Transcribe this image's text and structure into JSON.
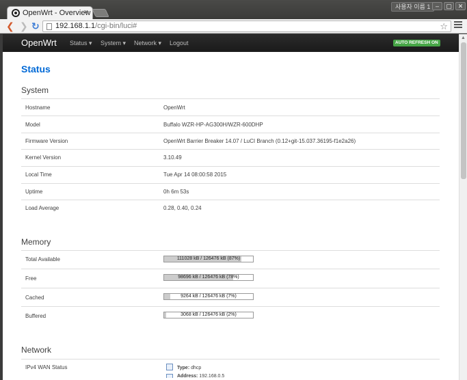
{
  "browser": {
    "tab_title": "OpenWrt - Overview",
    "tab_close": "×",
    "profile": "사용자 이름 1",
    "url_host": "192.168.1.1",
    "url_path": "/cgi-bin/luci#",
    "back_glyph": "❮",
    "forward_glyph": "❯",
    "reload_glyph": "↻",
    "star_glyph": "☆",
    "min_glyph": "‒",
    "max_glyph": "▢",
    "close_glyph": "✕"
  },
  "navbar": {
    "brand": "OpenWrt",
    "items": [
      {
        "label": "Status ▾"
      },
      {
        "label": "System ▾"
      },
      {
        "label": "Network ▾"
      },
      {
        "label": "Logout"
      }
    ],
    "auto_refresh": "AUTO REFRESH ON"
  },
  "page_title": "Status",
  "system": {
    "title": "System",
    "rows": [
      {
        "label": "Hostname",
        "value": "OpenWrt"
      },
      {
        "label": "Model",
        "value": "Buffalo WZR-HP-AG300H/WZR-600DHP"
      },
      {
        "label": "Firmware Version",
        "value": "OpenWrt Barrier Breaker 14.07 / LuCI Branch (0.12+git-15.037.36195-f1e2a26)"
      },
      {
        "label": "Kernel Version",
        "value": "3.10.49"
      },
      {
        "label": "Local Time",
        "value": "Tue Apr 14 08:00:58 2015"
      },
      {
        "label": "Uptime",
        "value": "0h 6m 53s"
      },
      {
        "label": "Load Average",
        "value": "0.28, 0.40, 0.24"
      }
    ]
  },
  "memory": {
    "title": "Memory",
    "rows": [
      {
        "label": "Total Available",
        "text": "111028 kB / 126476 kB (87%)",
        "percent": 87
      },
      {
        "label": "Free",
        "text": "98696 kB / 126476 kB (78%)",
        "percent": 78
      },
      {
        "label": "Cached",
        "text": "9264 kB / 126476 kB (7%)",
        "percent": 7
      },
      {
        "label": "Buffered",
        "text": "3068 kB / 126476 kB (2%)",
        "percent": 2
      }
    ]
  },
  "network": {
    "title": "Network",
    "rows": [
      {
        "label": "IPv4 WAN Status",
        "type_key": "Type:",
        "type_value": "dhcp",
        "address_key": "Address:",
        "address_value": "192.168.0.5"
      }
    ]
  }
}
